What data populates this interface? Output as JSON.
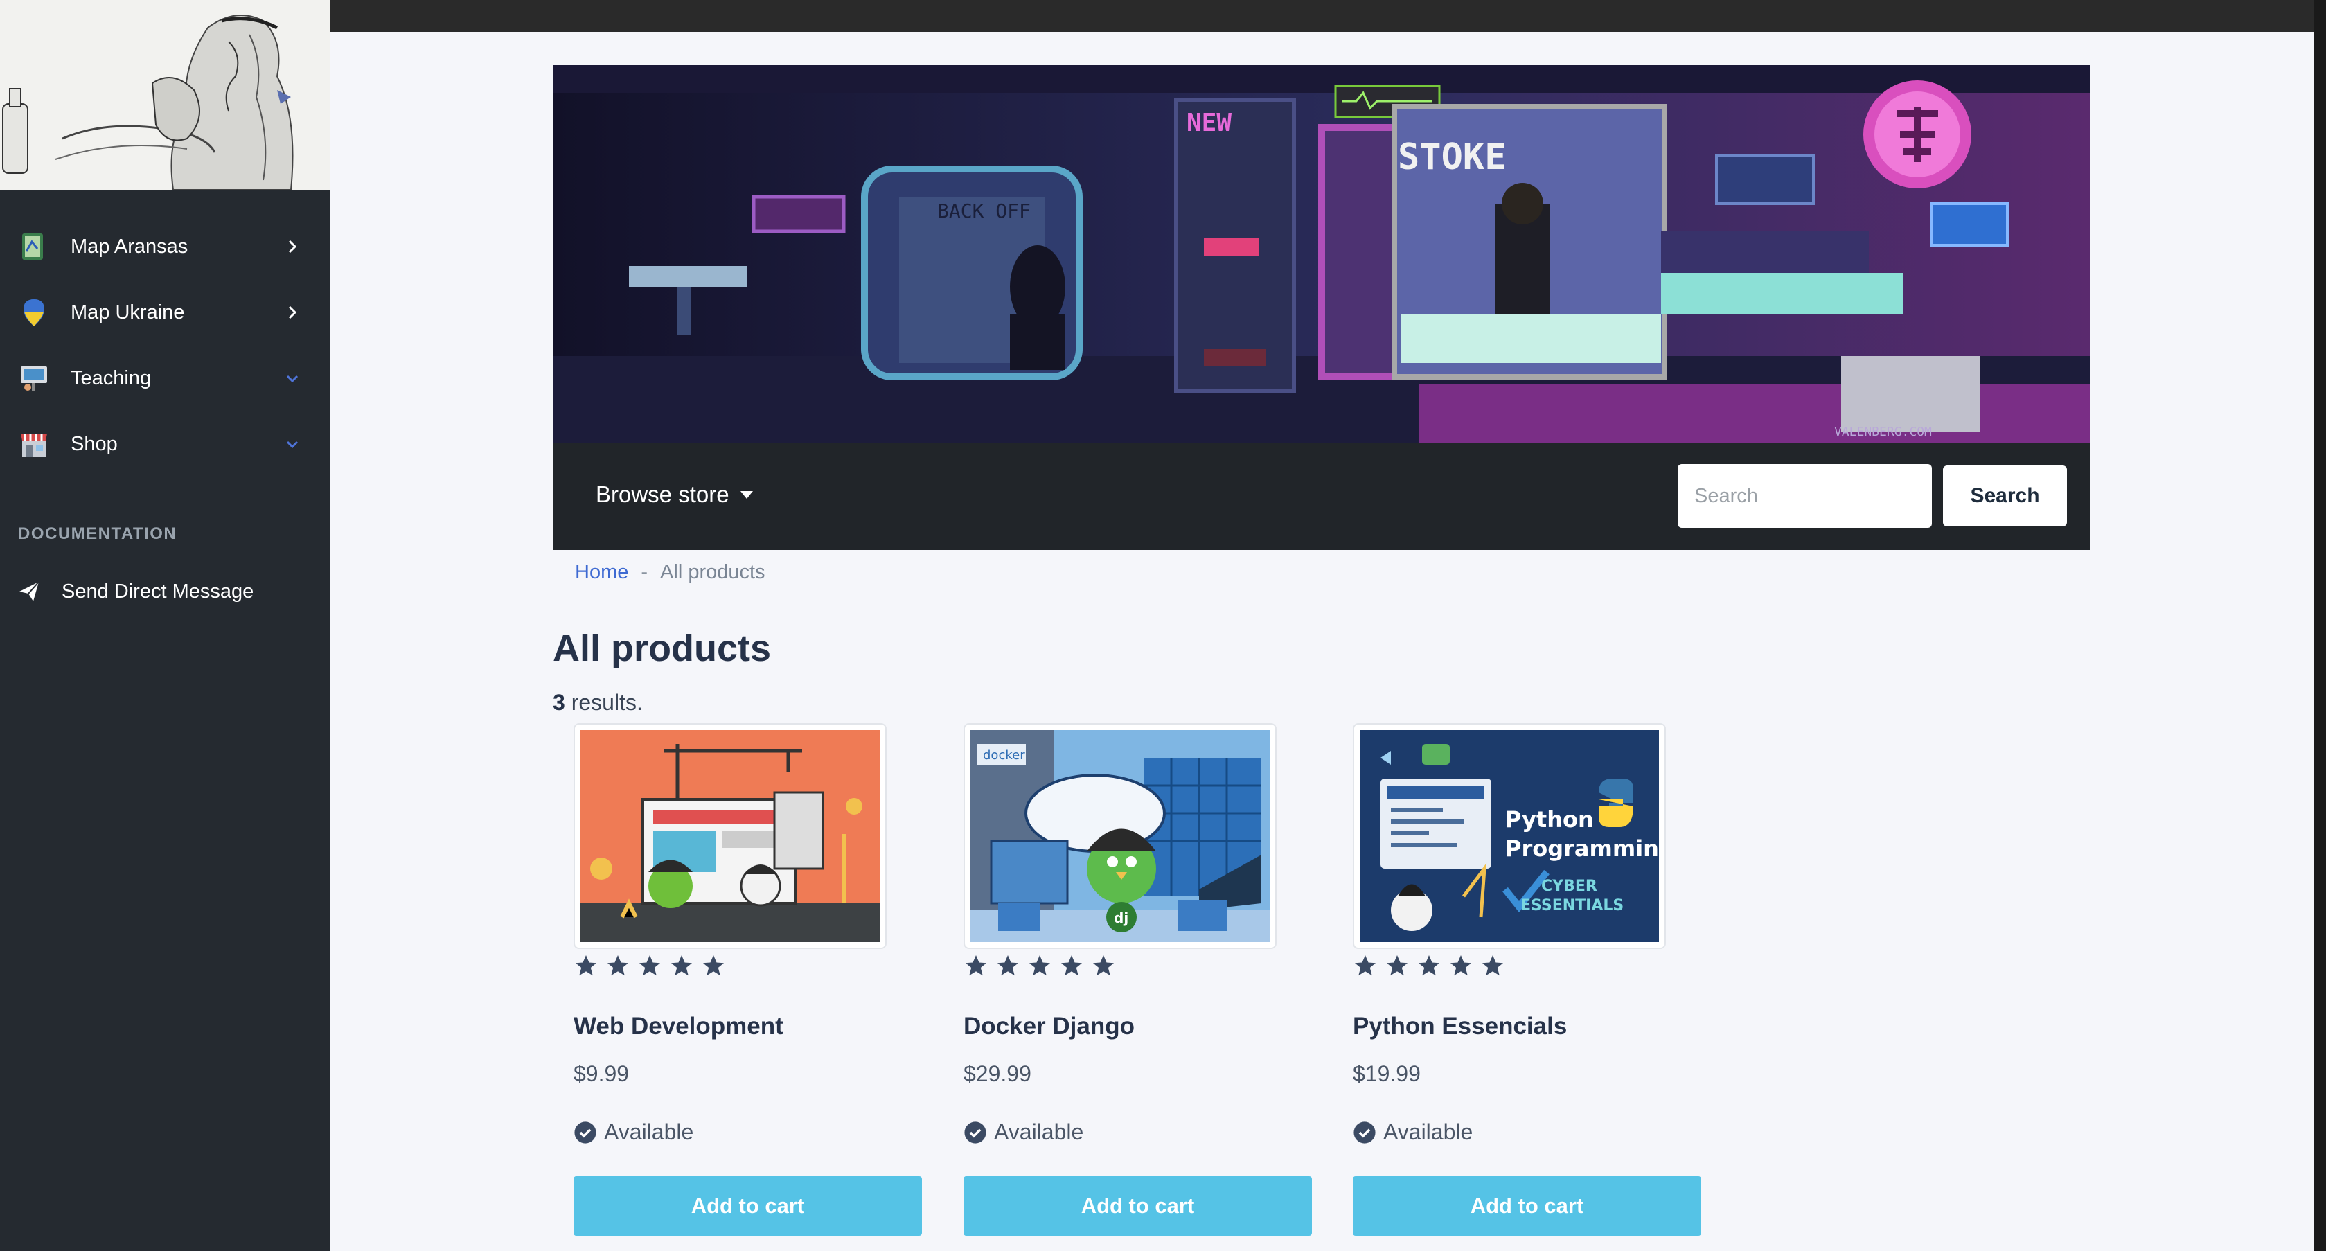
{
  "sidebar": {
    "items": [
      {
        "label": "Map Aransas",
        "icon": "map-icon"
      },
      {
        "label": "Map Ukraine",
        "icon": "pin-icon"
      },
      {
        "label": "Teaching",
        "icon": "presentation-icon"
      },
      {
        "label": "Shop",
        "icon": "store-icon"
      }
    ],
    "section_heading": "DOCUMENTATION",
    "dm_label": "Send Direct Message"
  },
  "store_nav": {
    "browse_label": "Browse store",
    "search_placeholder": "Search",
    "search_button": "Search"
  },
  "breadcrumb": {
    "home": "Home",
    "separator": "-",
    "current": "All products"
  },
  "page": {
    "title": "All products",
    "results_count": "3",
    "results_suffix": " results."
  },
  "products": [
    {
      "name": "Web Development",
      "price": "$9.99",
      "availability": "Available",
      "button": "Add to cart",
      "rating": 5
    },
    {
      "name": "Docker Django",
      "price": "$29.99",
      "availability": "Available",
      "button": "Add to cart",
      "rating": 5
    },
    {
      "name": "Python Essencials",
      "price": "$19.99",
      "availability": "Available",
      "button": "Add to cart",
      "rating": 5
    }
  ],
  "product_image_text": {
    "python_line1": "Python",
    "python_line2": "Programming",
    "cyber_line1": "CYBER",
    "cyber_line2": "ESSENTIALS",
    "docker_tag": "docker",
    "dj_tag": "dj"
  },
  "banner_text": {
    "sign_new": "NEW",
    "sign_back": "BACK OFF",
    "sign_store": "STOKE",
    "watermark": "VALENBERG.COM"
  },
  "colors": {
    "sidebar_bg": "#252a30",
    "accent_button": "#55c3e6",
    "link": "#3e6ad2",
    "store_nav_bg": "#212529"
  }
}
